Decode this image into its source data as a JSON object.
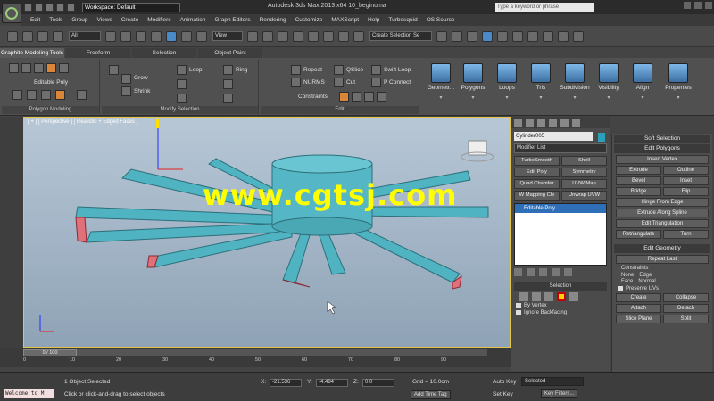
{
  "title_bar": {
    "workspace": "Workspace: Default",
    "title": "Autodesk 3ds Max 2013 x64    10_beginuma",
    "search_placeholder": "Type a keyword or phrase"
  },
  "menu": [
    "Edit",
    "Tools",
    "Group",
    "Views",
    "Create",
    "Modifiers",
    "Animation",
    "Graph Editors",
    "Rendering",
    "Customize",
    "MAXScript",
    "Help",
    "Turbosquid",
    "OS Source"
  ],
  "toolbar": {
    "selection_filter": "All",
    "reference_coord": "View",
    "named_selection": "Create Selection Se"
  },
  "ribbon": {
    "tabs": [
      "Graphite Modeling Tools",
      "Freeform",
      "Selection",
      "Object Paint"
    ],
    "polygon_modeling": {
      "label": "Polygon Modeling",
      "item": "Editable Poly"
    },
    "modify_selection": {
      "label": "Modify Selection",
      "grow": "Grow",
      "shrink": "Shrink",
      "loop": "Loop",
      "ring": "Ring"
    },
    "edit": {
      "label": "Edit",
      "repeat": "Repeat",
      "nurms": "NURMS",
      "constraints": "Constraints:",
      "qslice": "QSlice",
      "cut": "Cut",
      "swift_loop": "Swift Loop",
      "p_connect": "P Connect"
    },
    "big_buttons": [
      "Geometr...",
      "Polygons",
      "Loops",
      "Tris",
      "Subdivision",
      "Visibility",
      "Align",
      "Properties"
    ]
  },
  "viewport": {
    "label": "[ + ] [ Perspective ] [ Realistic + Edged Faces ]",
    "watermark": "www.cgtsj.com"
  },
  "command_panel": {
    "object_name": "Cylinder005",
    "modifier_list": "Modifier List",
    "modifier_buttons": [
      "TurboSmooth",
      "Shell",
      "Edit Poly",
      "Symmetry",
      "Quad Chamfer",
      "UVW Map",
      "W Mapping Cle",
      "Unwrap UVW"
    ],
    "stack_item": "Editable Poly",
    "selection_header": "Selection",
    "by_vertex": "By Vertex",
    "ignore_backfacing": "Ignore Backfacing"
  },
  "right_panel": {
    "soft_selection": "Soft Selection",
    "edit_polygons": "Edit Polygons",
    "insert_vertex": "Insert Vertex",
    "extrude": "Extrude",
    "outline": "Outline",
    "bevel": "Bevel",
    "inset": "Inset",
    "bridge": "Bridge",
    "flip": "Flip",
    "hinge_from_edge": "Hinge From Edge",
    "extrude_along_spline": "Extrude Along Spline",
    "edit_triangulation": "Edit Triangulation",
    "retriangulate": "Retriangulate",
    "turn": "Turn",
    "edit_geometry": "Edit Geometry",
    "repeat_last": "Repeat Last",
    "constraints": "Constraints",
    "none": "None",
    "edge": "Edge",
    "face": "Face",
    "normal": "Normal",
    "preserve_uvs": "Preserve UVs",
    "create": "Create",
    "collapse": "Collapse",
    "attach": "Attach",
    "detach": "Detach",
    "slice_plane": "Slice Plane",
    "split": "Split"
  },
  "timeline": {
    "frame": "0 / 100",
    "ticks": [
      "0",
      "10",
      "20",
      "30",
      "40",
      "50",
      "60",
      "70",
      "80",
      "90"
    ]
  },
  "status": {
    "welcome": "Welcome to M",
    "selected": "1 Object Selected",
    "prompt": "Click or click-and-drag to select objects",
    "x": "-21.536",
    "y": "-4.484",
    "z": "0.0",
    "grid": "Grid = 10.0cm",
    "add_time_tag": "Add Time Tag",
    "auto_key": "Auto Key",
    "selected_dd": "Selected",
    "set_key": "Set Key",
    "key_filters": "Key Filters..."
  }
}
